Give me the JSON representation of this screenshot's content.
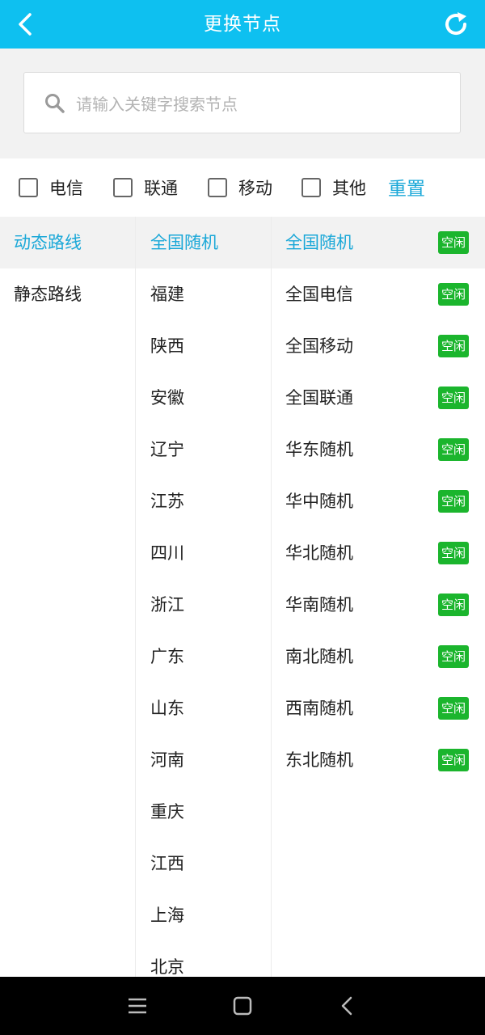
{
  "header": {
    "title": "更换节点",
    "back_icon": "chevron-left-icon",
    "refresh_icon": "refresh-icon",
    "color": "#0ec0f0"
  },
  "search": {
    "placeholder": "请输入关键字搜索节点",
    "value": "",
    "icon": "search-icon"
  },
  "filters": [
    {
      "label": "电信",
      "checked": false
    },
    {
      "label": "联通",
      "checked": false
    },
    {
      "label": "移动",
      "checked": false
    },
    {
      "label": "其他",
      "checked": false
    }
  ],
  "reset_label": "重置",
  "route_types": [
    {
      "label": "动态路线",
      "selected": true
    },
    {
      "label": "静态路线",
      "selected": false
    }
  ],
  "regions": [
    {
      "label": "全国随机",
      "selected": true
    },
    {
      "label": "福建"
    },
    {
      "label": "陕西"
    },
    {
      "label": "安徽"
    },
    {
      "label": "辽宁"
    },
    {
      "label": "江苏"
    },
    {
      "label": "四川"
    },
    {
      "label": "浙江"
    },
    {
      "label": "广东"
    },
    {
      "label": "山东"
    },
    {
      "label": "河南"
    },
    {
      "label": "重庆"
    },
    {
      "label": "江西"
    },
    {
      "label": "上海"
    },
    {
      "label": "北京"
    }
  ],
  "nodes": [
    {
      "label": "全国随机",
      "status": "空闲",
      "selected": true
    },
    {
      "label": "全国电信",
      "status": "空闲"
    },
    {
      "label": "全国移动",
      "status": "空闲"
    },
    {
      "label": "全国联通",
      "status": "空闲"
    },
    {
      "label": "华东随机",
      "status": "空闲"
    },
    {
      "label": "华中随机",
      "status": "空闲"
    },
    {
      "label": "华北随机",
      "status": "空闲"
    },
    {
      "label": "华南随机",
      "status": "空闲"
    },
    {
      "label": "南北随机",
      "status": "空闲"
    },
    {
      "label": "西南随机",
      "status": "空闲"
    },
    {
      "label": "东北随机",
      "status": "空闲"
    }
  ],
  "colors": {
    "accent": "#1ba8d8",
    "status_idle": "#1bb52d"
  },
  "navbar": {
    "icons": [
      "menu-icon",
      "home-icon",
      "back-icon"
    ]
  }
}
